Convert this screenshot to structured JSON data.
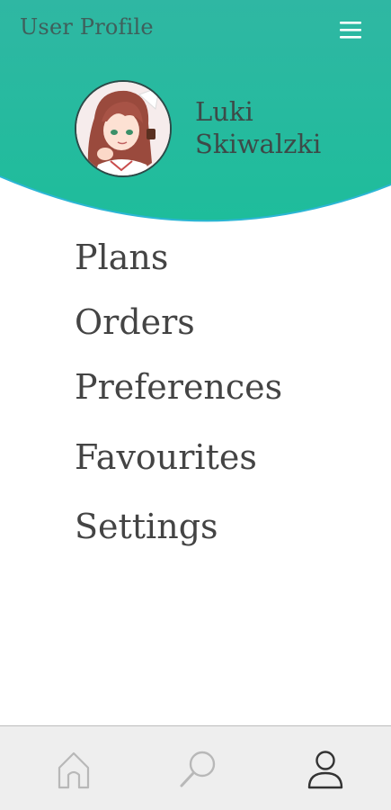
{
  "header": {
    "title": "User Profile",
    "menu_icon": "hamburger-menu-icon",
    "gradient": [
      "#2eb7a2",
      "#1fbc9c"
    ],
    "curve_border": "#29b8d2"
  },
  "profile": {
    "name_first": "Luki",
    "name_last": "Skiwalzki",
    "avatar_description": "anime-girl-avatar"
  },
  "menu": {
    "items": [
      {
        "label": "Plans"
      },
      {
        "label": "Orders"
      },
      {
        "label": "Preferences"
      },
      {
        "label": "Favourites"
      },
      {
        "label": "Settings"
      }
    ]
  },
  "bottom_nav": {
    "items": [
      {
        "icon": "home-icon",
        "active": false
      },
      {
        "icon": "search-icon",
        "active": false
      },
      {
        "icon": "user-icon",
        "active": true
      }
    ],
    "inactive_color": "#b8b8b8",
    "active_color": "#333333"
  }
}
